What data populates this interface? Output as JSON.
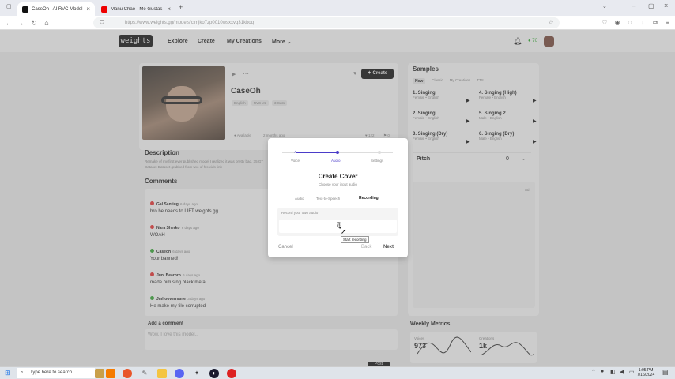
{
  "browser": {
    "tabs": [
      {
        "title": "CaseOh | AI RVC Model",
        "active": true
      },
      {
        "title": "Manu Chao - Me Gustas Tu (Off",
        "active": false
      }
    ],
    "url": "https://www.weights.gg/models/clmjko7zp0010wsxxvq31kboq"
  },
  "site": {
    "logo": "weights",
    "nav": [
      "Explore",
      "Create",
      "My Creations",
      "More"
    ],
    "credits": "70"
  },
  "model": {
    "name": "CaseOh",
    "tags": [
      "English",
      "RVC V2",
      "3 Cats"
    ],
    "meta": "Available",
    "age": "2 months ago",
    "create_label": "Create",
    "likes": "122",
    "saves": "0"
  },
  "description": {
    "heading": "Description",
    "text": "Remake of my first ever published model I realized it was pretty bad. 35 GT Dataset Dataset grabbed from two of his vids link"
  },
  "comments": {
    "heading": "Comments",
    "items": [
      {
        "name": "Gal Santiug",
        "age": "6 days ago",
        "text": "bro he needs to LIFT weights.gg"
      },
      {
        "name": "Nara Sherko",
        "age": "6 days ago",
        "text": "WOAH"
      },
      {
        "name": "Caseoh",
        "age": "6 days ago",
        "text": "Your banned!"
      },
      {
        "name": "Juni Bearbro",
        "age": "6 days ago",
        "text": "made him sing black metal"
      },
      {
        "name": "Jmhoovername",
        "age": "3 days ago",
        "text": "He make my file corrupted"
      }
    ],
    "add_heading": "Add a comment",
    "placeholder": "Wow, I love this model...",
    "post_label": "Post"
  },
  "samples": {
    "heading": "Samples",
    "tabs": [
      "New",
      "Classic",
      "My Creations",
      "TTS"
    ],
    "items": [
      {
        "title": "1. Singing",
        "sub": "Female • English"
      },
      {
        "title": "4. Singing (High)",
        "sub": "Female • English"
      },
      {
        "title": "2. Singing",
        "sub": "Female • English"
      },
      {
        "title": "5. Singing 2",
        "sub": "Male • English"
      },
      {
        "title": "3. Singing (Dry)",
        "sub": "Female • English"
      },
      {
        "title": "6. Singing (Dry)",
        "sub": "Male • English"
      }
    ],
    "pitch_label": "Pitch",
    "pitch_value": "0",
    "ad_label": "Ad"
  },
  "metrics": {
    "heading": "Weekly Metrics",
    "a_label": "Voices",
    "a_value": "973",
    "b_label": "Creations",
    "b_value": "1k"
  },
  "modal": {
    "steps": [
      "Voice",
      "Audio",
      "Settings"
    ],
    "title": "Create Cover",
    "subtitle": "Choose your input audio",
    "tabs": [
      "Audio",
      "Text-to-Speech",
      "Recording"
    ],
    "record_label": "Record your own audio",
    "tooltip": "Start recording",
    "cancel": "Cancel",
    "back": "Back",
    "next": "Next"
  },
  "taskbar": {
    "search_placeholder": "Type here to search",
    "time": "1:05 PM",
    "date": "7/16/2024"
  }
}
